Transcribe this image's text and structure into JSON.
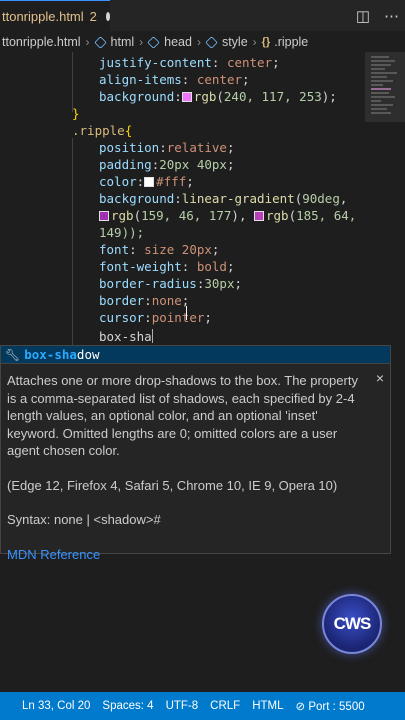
{
  "tab": {
    "title": "ttonripple.html",
    "problems_count": "2"
  },
  "breadcrumb": [
    {
      "label": "ttonripple.html",
      "icon": "none"
    },
    {
      "label": "html",
      "icon": "cube-icon"
    },
    {
      "label": "head",
      "icon": "cube-icon"
    },
    {
      "label": "style",
      "icon": "cube-icon"
    },
    {
      "label": ".ripple",
      "icon": "css-icon"
    }
  ],
  "code": {
    "l1": {
      "prop": "justify-content",
      "val": "center"
    },
    "l2": {
      "prop": "align-items",
      "val": "center"
    },
    "l3": {
      "prop": "background",
      "fn": "rgb",
      "args": "240, 117, 253",
      "swatch": "#f075fd"
    },
    "l4": {
      "brace": "}"
    },
    "l5": {
      "selector": ".ripple",
      "brace": "{"
    },
    "l6": {
      "prop": "position",
      "val": "relative"
    },
    "l7": {
      "prop": "padding",
      "val": "20px 40px"
    },
    "l8": {
      "prop": "color",
      "val": "#fff",
      "swatch": "#ffffff"
    },
    "l9": {
      "prop": "background",
      "fn": "linear-gradient",
      "arg": "90deg"
    },
    "l10": {
      "fn1": "rgb",
      "args1": "159, 46, 177",
      "swatch1": "#9f2eb1",
      "fn2": "rgb",
      "args2": "185, 64,",
      "swatch2": "#b940b9"
    },
    "l11": {
      "text": "149));"
    },
    "l12": {
      "prop": "font",
      "val": "size 20px"
    },
    "l13": {
      "prop": "font-weight",
      "val": "bold"
    },
    "l14": {
      "prop": "border-radius",
      "val": "30px"
    },
    "l15": {
      "prop": "border",
      "val": "none"
    },
    "l16": {
      "prop": "cursor",
      "val": "pointer"
    },
    "l17": {
      "text": "box-sha"
    }
  },
  "suggest": {
    "match": "box-sha",
    "rest": "dow"
  },
  "details": {
    "description": "Attaches one or more drop-shadows to the box. The property is a comma-separated list of shadows, each specified by 2-4 length values, an optional color, and an optional 'inset' keyword. Omitted lengths are 0; omitted colors are a user agent chosen color.",
    "browsers": "(Edge 12, Firefox 4, Safari 5, Chrome 10, IE 9, Opera 10)",
    "syntax": "Syntax: none | <shadow>#",
    "link": "MDN Reference",
    "close": "×"
  },
  "logo": {
    "text": "CWS"
  },
  "status": {
    "position": "Ln 33, Col 20",
    "spaces": "Spaces: 4",
    "encoding": "UTF-8",
    "eol": "CRLF",
    "language": "HTML",
    "port": "Port : 5500"
  },
  "colors": {
    "accent": "#007acc",
    "editor_bg": "#1e1e1e",
    "link": "#3794ff"
  }
}
